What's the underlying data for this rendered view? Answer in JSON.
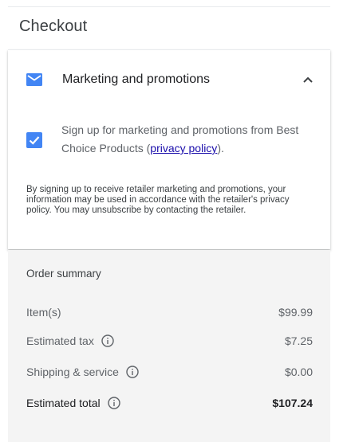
{
  "header": {
    "title": "Checkout"
  },
  "marketing": {
    "section_title": "Marketing and promotions",
    "checkbox_checked": true,
    "consent_before": "Sign up for marketing and promotions from Best Choice Products (",
    "consent_link": "privacy policy",
    "consent_after": ").",
    "disclaimer": "By signing up to receive retailer marketing and promotions, your information may be used in accordance with the retailer's privacy policy. You may unsubscribe by contacting the retailer.",
    "accent_color": "#4285f4"
  },
  "summary": {
    "title": "Order summary",
    "items_label": "Item(s)",
    "items_value": "$99.99",
    "tax_label": "Estimated tax",
    "tax_value": "$7.25",
    "shipping_label": "Shipping & service",
    "shipping_value": "$0.00",
    "total_label": "Estimated total",
    "total_value": "$107.24"
  },
  "icons": {
    "mail": "mail-icon",
    "chevron": "chevron-up-icon",
    "checkbox": "checkbox-checked-icon",
    "info": "info-icon"
  }
}
